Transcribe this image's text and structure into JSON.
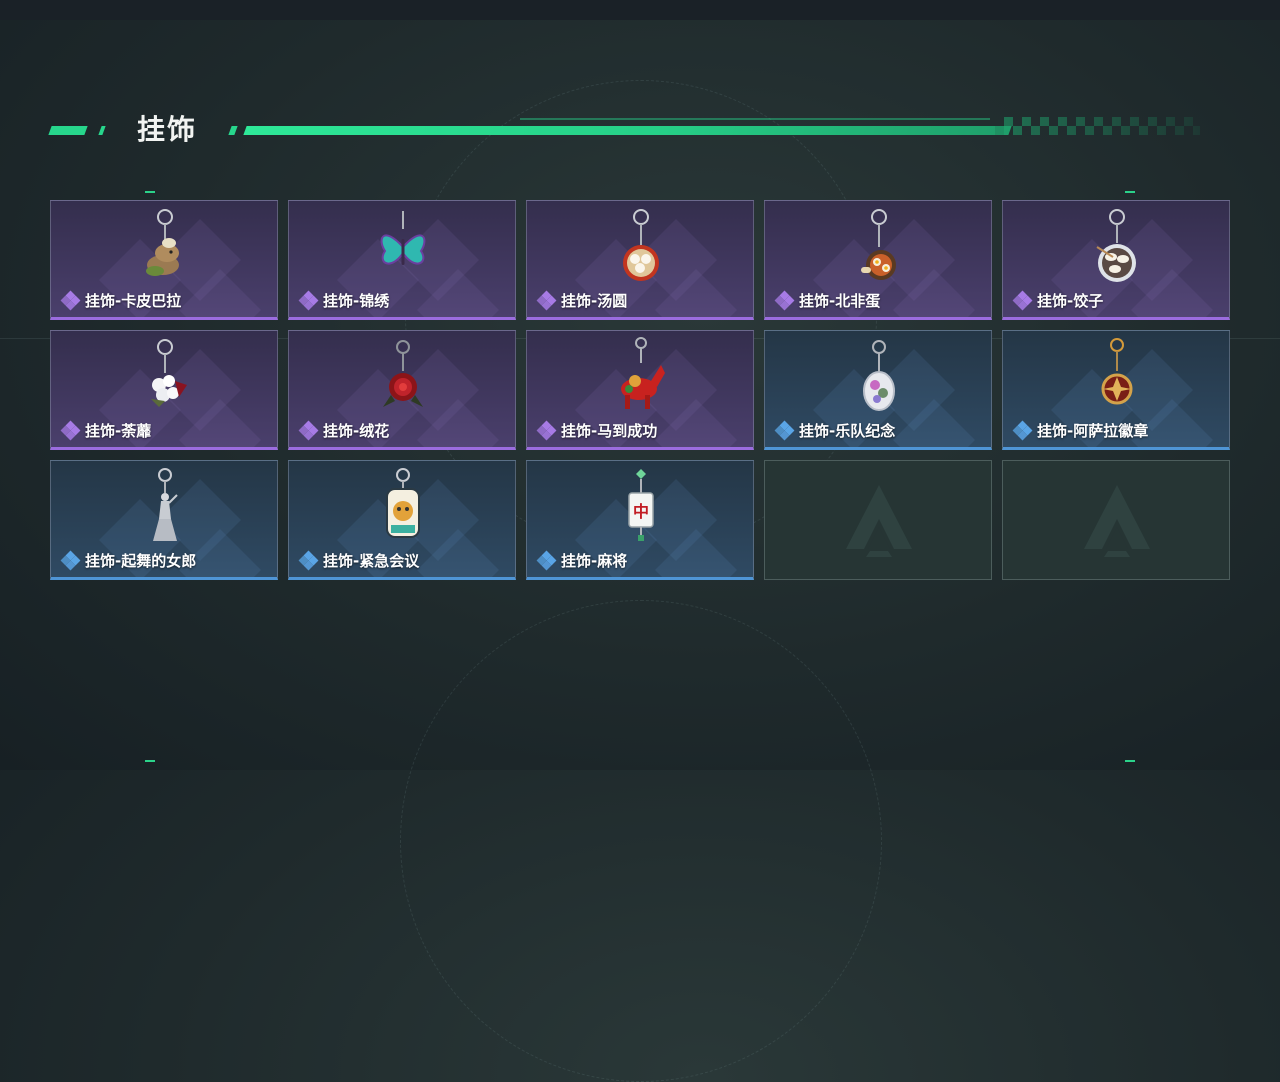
{
  "section": {
    "title": "挂饰"
  },
  "colors": {
    "accent": "#27d68c",
    "purple_rarity": "#9b6cdf",
    "blue_rarity": "#4f95d6"
  },
  "items": [
    {
      "name": "挂饰-卡皮巴拉",
      "rarity": "purple",
      "icon": "capybara-charm-icon"
    },
    {
      "name": "挂饰-锦绣",
      "rarity": "purple",
      "icon": "butterfly-charm-icon"
    },
    {
      "name": "挂饰-汤圆",
      "rarity": "purple",
      "icon": "tangyuan-bowl-charm-icon"
    },
    {
      "name": "挂饰-北非蛋",
      "rarity": "purple",
      "icon": "shakshuka-charm-icon"
    },
    {
      "name": "挂饰-饺子",
      "rarity": "purple",
      "icon": "dumpling-plate-charm-icon"
    },
    {
      "name": "挂饰-荼蘼",
      "rarity": "purple",
      "icon": "flower-bouquet-charm-icon"
    },
    {
      "name": "挂饰-绒花",
      "rarity": "purple",
      "icon": "red-velvet-flower-charm-icon"
    },
    {
      "name": "挂饰-马到成功",
      "rarity": "purple",
      "icon": "red-horse-charm-icon"
    },
    {
      "name": "挂饰-乐队纪念",
      "rarity": "blue",
      "icon": "band-badge-charm-icon"
    },
    {
      "name": "挂饰-阿萨拉徽章",
      "rarity": "blue",
      "icon": "asala-emblem-charm-icon"
    },
    {
      "name": "挂饰-起舞的女郎",
      "rarity": "blue",
      "icon": "dancing-lady-charm-icon"
    },
    {
      "name": "挂饰-紧急会议",
      "rarity": "blue",
      "icon": "emergency-meeting-charm-icon"
    },
    {
      "name": "挂饰-麻将",
      "rarity": "blue",
      "icon": "mahjong-tile-charm-icon"
    },
    {
      "name": "",
      "rarity": "empty",
      "icon": "empty-slot-logo-icon"
    },
    {
      "name": "",
      "rarity": "empty",
      "icon": "empty-slot-logo-icon"
    }
  ]
}
